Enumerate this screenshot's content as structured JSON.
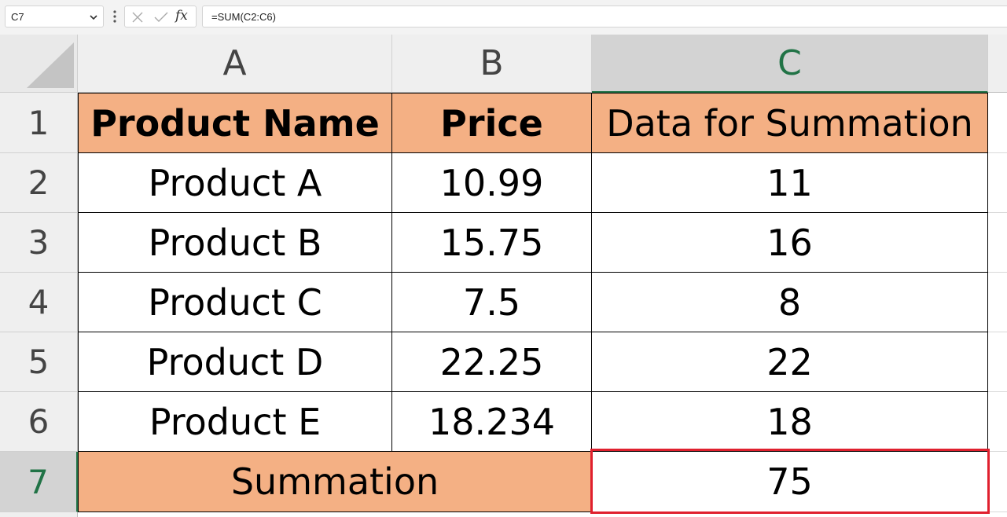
{
  "formula_bar": {
    "name_box": "C7",
    "cancel_icon": "close-icon",
    "enter_icon": "check-icon",
    "fx_label": "fx",
    "formula": "=SUM(C2:C6)"
  },
  "columns": [
    "A",
    "B",
    "C"
  ],
  "rows": [
    "1",
    "2",
    "3",
    "4",
    "5",
    "6",
    "7"
  ],
  "selected_cell": "C7",
  "header_row": {
    "product_name": "Product Name",
    "price": "Price",
    "data_for_summation": "Data for Summation"
  },
  "data_rows": [
    {
      "name": "Product A",
      "price": "10.99",
      "value": "11"
    },
    {
      "name": "Product B",
      "price": "15.75",
      "value": "16"
    },
    {
      "name": "Product C",
      "price": "7.5",
      "value": "8"
    },
    {
      "name": "Product D",
      "price": "22.25",
      "value": "22"
    },
    {
      "name": "Product E",
      "price": "18.234",
      "value": "18"
    }
  ],
  "summary_row": {
    "label": "Summation",
    "total": "75"
  },
  "colors": {
    "header_fill": "#f4b084",
    "selection_border": "#e0202e",
    "selected_header_text": "#217346"
  }
}
